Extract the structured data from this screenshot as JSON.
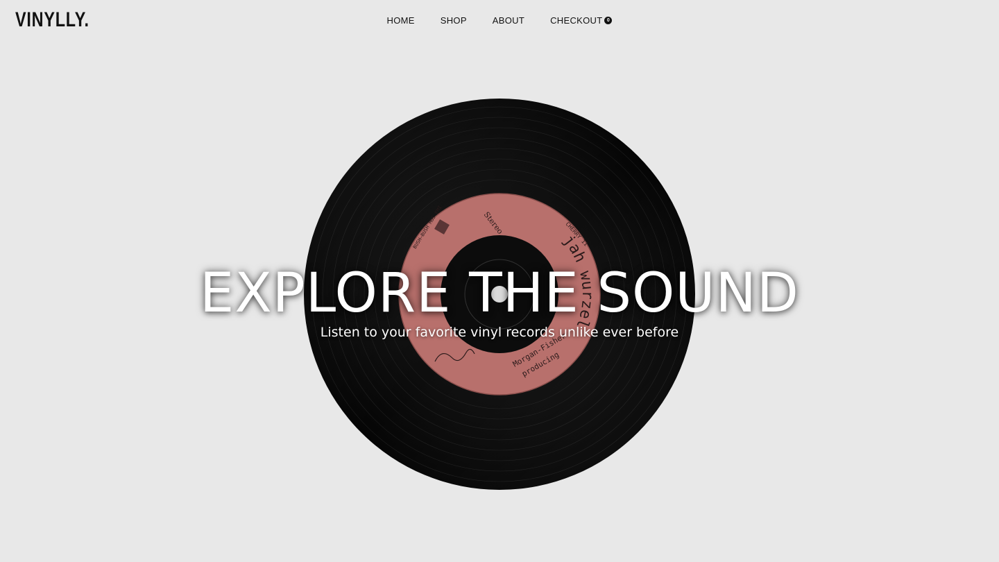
{
  "brand": {
    "logo_text": "VINYLLY."
  },
  "nav": {
    "items": [
      {
        "label": "HOME"
      },
      {
        "label": "SHOP"
      },
      {
        "label": "ABOUT"
      },
      {
        "label": "CHECKOUT"
      }
    ],
    "cart_count": "0"
  },
  "hero": {
    "title": "EXPLORE THE SOUND",
    "subtitle": "Listen to your favorite vinyl records unlike ever before"
  },
  "record_label": {
    "artist": "jah wurzel",
    "stereo": "Stereo",
    "catalog": "CHERRY 11",
    "publisher": "BUSH—BUSH MUS EMI",
    "producer_line1": "Morgan-Fisher",
    "producer_line2": "producing",
    "label_color": "#b8706c"
  },
  "colors": {
    "background": "#e8e8e8",
    "text": "#111111",
    "hero_text": "#ffffff"
  }
}
